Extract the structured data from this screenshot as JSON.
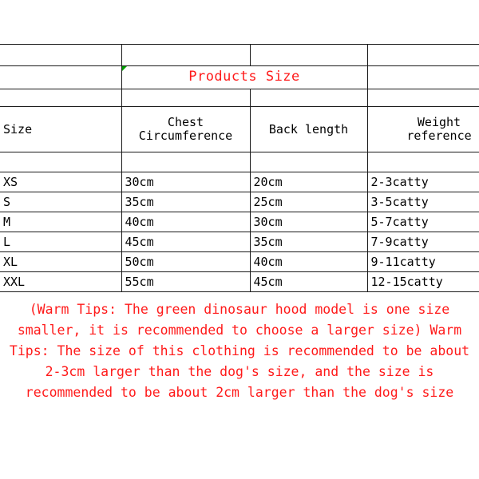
{
  "document": {
    "kind": "product-size-chart",
    "title": "Products Size",
    "title_color": "#ff1a1a",
    "border_color": "#1a1a1a",
    "indicator_color": "#00a000",
    "indicator_name": "green-comment-triangle"
  },
  "table": {
    "title": "Products Size",
    "headers": {
      "size": "Size",
      "chest_line1": "Chest",
      "chest_line2": "Circumference",
      "back": "Back length",
      "weight_line1": "Weight",
      "weight_line2": "reference"
    },
    "columns": [
      "Size",
      "Chest Circumference",
      "Back length",
      "Weight reference"
    ],
    "rows": [
      {
        "size": "XS",
        "chest": "30cm",
        "back": "20cm",
        "weight": "2-3catty"
      },
      {
        "size": "S",
        "chest": "35cm",
        "back": "25cm",
        "weight": "3-5catty"
      },
      {
        "size": "M",
        "chest": "40cm",
        "back": "30cm",
        "weight": "5-7catty"
      },
      {
        "size": "L",
        "chest": "45cm",
        "back": "35cm",
        "weight": "7-9catty"
      },
      {
        "size": "XL",
        "chest": "50cm",
        "back": "40cm",
        "weight": "9-11catty"
      },
      {
        "size": "XXL",
        "chest": "55cm",
        "back": "45cm",
        "weight": "12-15catty"
      }
    ]
  },
  "warning": {
    "text": "(Warm Tips: The green dinosaur hood model is one size smaller, it is recommended to choose a larger size) Warm Tips: The size of this clothing is recommended to be about 2-3cm larger than the dog's size, and the size is recommended to be about 2cm larger than the dog's size",
    "color": "#ff1a1a"
  }
}
